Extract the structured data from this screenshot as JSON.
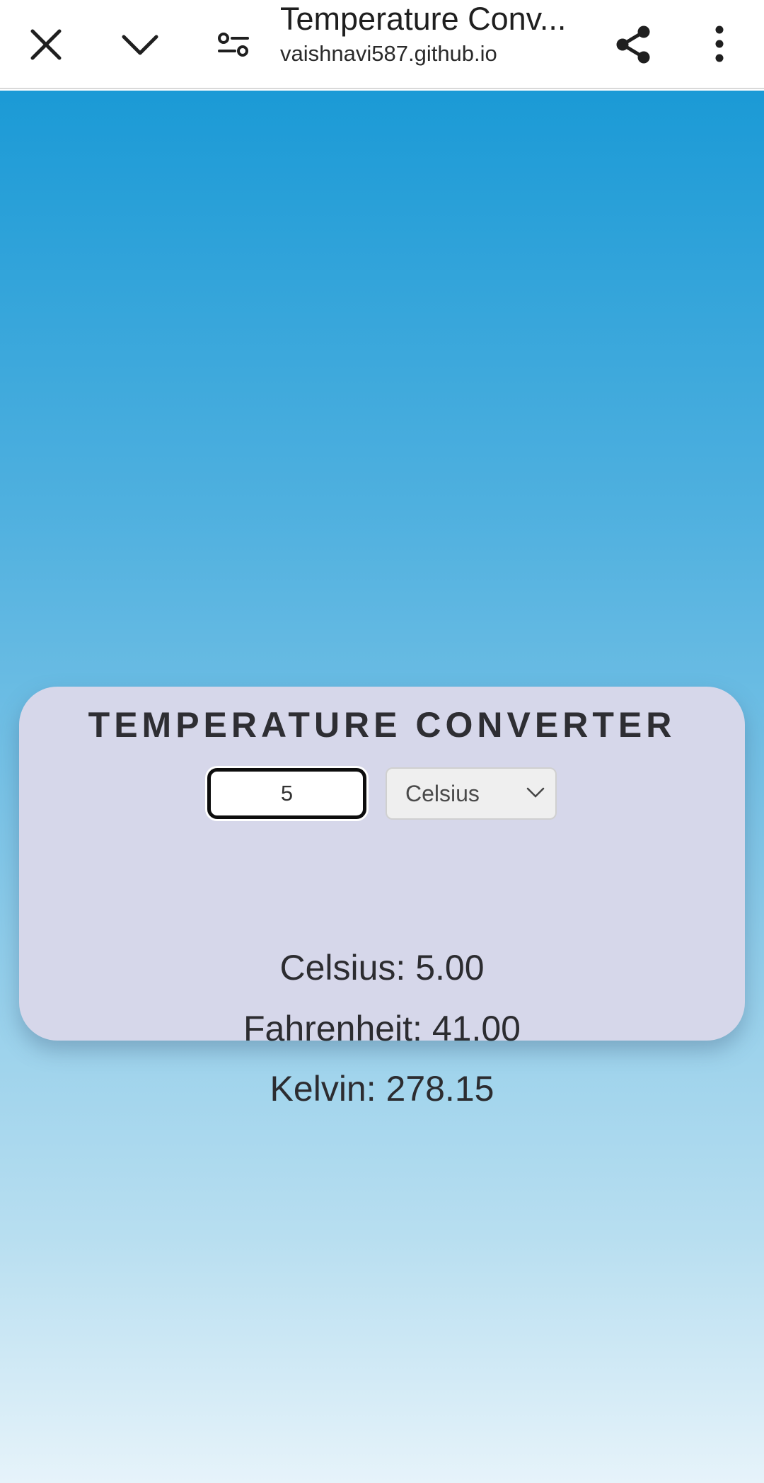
{
  "toolbar": {
    "title": "Temperature Conv...",
    "url": "vaishnavi587.github.io",
    "close_icon": "close-icon",
    "minimize_icon": "chevron-down-icon",
    "settings_icon": "tune-icon",
    "share_icon": "share-icon",
    "more_icon": "more-vert-icon"
  },
  "converter": {
    "heading": "TEMPERATURE CONVERTER",
    "input_value": "5",
    "selected_unit": "Celsius",
    "results": {
      "celsius": "Celsius: 5.00",
      "fahrenheit": "Fahrenheit: 41.00",
      "kelvin": "Kelvin: 278.15"
    }
  },
  "colors": {
    "gradient_top": "#1b9ad6",
    "gradient_bottom": "#e6f3fa",
    "card_background": "#d6d7ea"
  }
}
